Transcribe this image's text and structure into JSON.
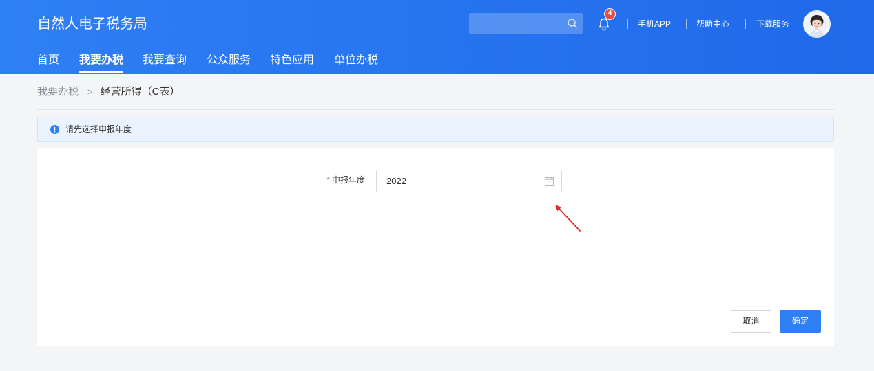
{
  "header": {
    "title": "自然人电子税务局",
    "search": {
      "value": ""
    },
    "notification_count": "4",
    "links": [
      "手机APP",
      "帮助中心",
      "下载服务"
    ],
    "nav": [
      {
        "label": "首页",
        "active": false
      },
      {
        "label": "我要办税",
        "active": true
      },
      {
        "label": "我要查询",
        "active": false
      },
      {
        "label": "公众服务",
        "active": false
      },
      {
        "label": "特色应用",
        "active": false
      },
      {
        "label": "单位办税",
        "active": false
      }
    ]
  },
  "breadcrumb": {
    "items": [
      "我要办税",
      "经营所得（C表）"
    ],
    "separator": ">"
  },
  "alert": {
    "message": "请先选择申报年度"
  },
  "form": {
    "year": {
      "required_mark": "*",
      "label": "申报年度",
      "value": "2022"
    }
  },
  "actions": {
    "cancel_label": "取消",
    "confirm_label": "确定"
  },
  "icons": {
    "search": "search-icon",
    "notification": "bell-icon",
    "alert": "info-icon",
    "date_picker": "calendar-icon",
    "avatar": "user-avatar",
    "annotation": "arrow"
  },
  "colors": {
    "header_start": "#2f7ff4",
    "header_end": "#1f69ea",
    "primary": "#2e7ff2",
    "badge": "#f04a3e",
    "alert_bg": "#eaf3fe",
    "annotation": "#e02a2a"
  }
}
